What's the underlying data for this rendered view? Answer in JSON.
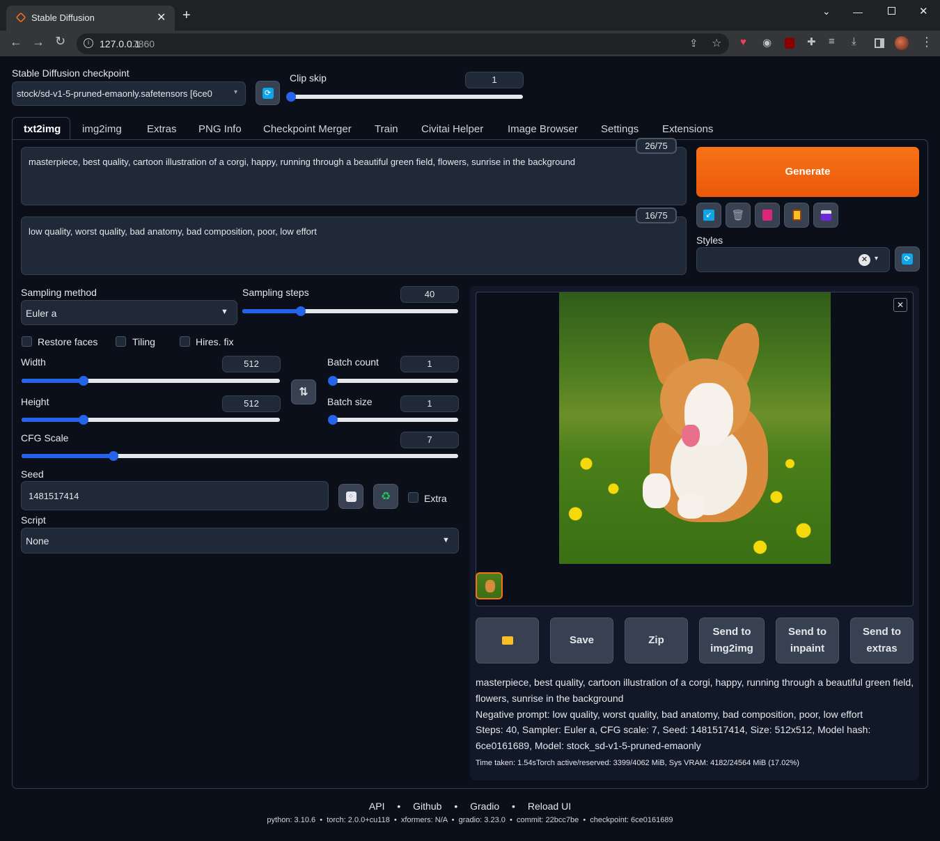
{
  "browser": {
    "tab_title": "Stable Diffusion",
    "url_host": "127.0.0.1",
    "url_port": ":7860"
  },
  "top": {
    "checkpoint_label": "Stable Diffusion checkpoint",
    "checkpoint_value": "stock/sd-v1-5-pruned-emaonly.safetensors [6ce0",
    "clip_skip_label": "Clip skip",
    "clip_skip_value": "1"
  },
  "tabs": [
    "txt2img",
    "img2img",
    "Extras",
    "PNG Info",
    "Checkpoint Merger",
    "Train",
    "Civitai Helper",
    "Image Browser",
    "Settings",
    "Extensions"
  ],
  "prompt": {
    "positive": "masterpiece, best quality, cartoon illustration of a corgi, happy, running through a beautiful green field, flowers, sunrise in the background",
    "positive_tokens": "26/75",
    "negative": "low quality, worst quality, bad anatomy, bad composition, poor, low effort",
    "negative_tokens": "16/75"
  },
  "generate_label": "Generate",
  "styles_label": "Styles",
  "params": {
    "sampling_method_label": "Sampling method",
    "sampling_method": "Euler a",
    "sampling_steps_label": "Sampling steps",
    "sampling_steps": "40",
    "restore_faces": "Restore faces",
    "tiling": "Tiling",
    "hires_fix": "Hires. fix",
    "width_label": "Width",
    "width": "512",
    "height_label": "Height",
    "height": "512",
    "batch_count_label": "Batch count",
    "batch_count": "1",
    "batch_size_label": "Batch size",
    "batch_size": "1",
    "cfg_label": "CFG Scale",
    "cfg": "7",
    "seed_label": "Seed",
    "seed": "1481517414",
    "extra_label": "Extra",
    "script_label": "Script",
    "script": "None"
  },
  "slider_levels": {
    "clip_skip": 0.0,
    "sampling_steps": 0.27,
    "width": 0.24,
    "height": 0.24,
    "batch_count": 0.0,
    "batch_size": 0.0,
    "cfg": 0.21
  },
  "output_buttons": {
    "save": "Save",
    "zip": "Zip",
    "send_img2img": "Send to img2img",
    "send_inpaint": "Send to inpaint",
    "send_extras": "Send to extras"
  },
  "info": {
    "line1": "masterpiece, best quality, cartoon illustration of a corgi, happy, running through a beautiful green field, flowers, sunrise in the background",
    "line2": "Negative prompt: low quality, worst quality, bad anatomy, bad composition, poor, low effort",
    "line3": "Steps: 40, Sampler: Euler a, CFG scale: 7, Seed: 1481517414, Size: 512x512, Model hash: 6ce0161689, Model: stock_sd-v1-5-pruned-emaonly",
    "time": "Time taken: 1.54sTorch active/reserved: 3399/4062 MiB, Sys VRAM: 4182/24564 MiB (17.02%)"
  },
  "footer": {
    "links": [
      "API",
      "Github",
      "Gradio",
      "Reload UI"
    ],
    "versions": "python: 3.10.6  •  torch: 2.0.0+cu118  •  xformers: N/A  •  gradio: 3.23.0  •  commit: 22bcc7be  •  checkpoint: 6ce0161689"
  },
  "colors": {
    "accent": "#2563eb",
    "generate": "#ea580c",
    "background": "#0b0f19"
  }
}
